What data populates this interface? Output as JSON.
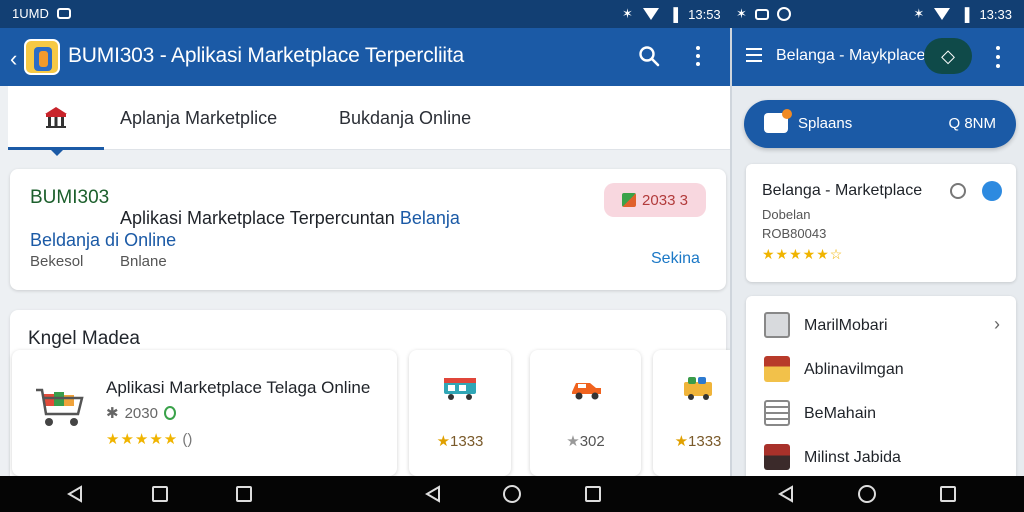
{
  "status_bar": {
    "left_text": "1UMD",
    "time_left": "13:53",
    "time_right": "13:33"
  },
  "left_app": {
    "title": "BUMI303 - Aplikasi Marketplace Terpercliita",
    "tabs": [
      {
        "label": "Aplanja Marketplice"
      },
      {
        "label": "Bukdanja Online"
      }
    ],
    "banner": {
      "brand": "BUMI303",
      "headline_plain": "Aplikasi Marketplace Terpercuntan",
      "headline_highlight": "Belanja",
      "headline_line2": "Beldanja di Online",
      "sub1": "Bekesol",
      "sub2": "Bnlane",
      "see_all": "Sekina",
      "badge_text": "2033 3"
    },
    "section": {
      "title": "Kngel Madea",
      "main_card": {
        "name": "Aplikasi Marketplace Telaga Online",
        "meta": "2030",
        "stars": "★★★★★",
        "rating_suffix": "()"
      },
      "small_cards": [
        {
          "rating": "1333",
          "icon": "truck-icon"
        },
        {
          "rating": "302",
          "icon": "car-icon"
        },
        {
          "rating": "1333",
          "icon": "shop-icon"
        }
      ]
    }
  },
  "right_app": {
    "title": "Belanga - Maykplace",
    "search": {
      "label": "Splaans",
      "right": "Q 8NM"
    },
    "card": {
      "title": "Belanga - Marketplace",
      "sub1": "Dobelan",
      "sub2": "ROB80043",
      "stars": "★★★★★☆"
    },
    "list": [
      {
        "label": "MarilMobari",
        "icon": "bag-icon",
        "chevron": true
      },
      {
        "label": "Ablinavilmgan",
        "icon": "store-icon",
        "chevron": false
      },
      {
        "label": "BeMahain",
        "icon": "document-icon",
        "chevron": false
      },
      {
        "label": "Milinst Jabida",
        "icon": "market-icon",
        "chevron": false
      }
    ]
  },
  "colors": {
    "primary": "#1b5aa6",
    "status": "#123f73",
    "star": "#f0b400",
    "brand_green": "#1c5f2c"
  }
}
